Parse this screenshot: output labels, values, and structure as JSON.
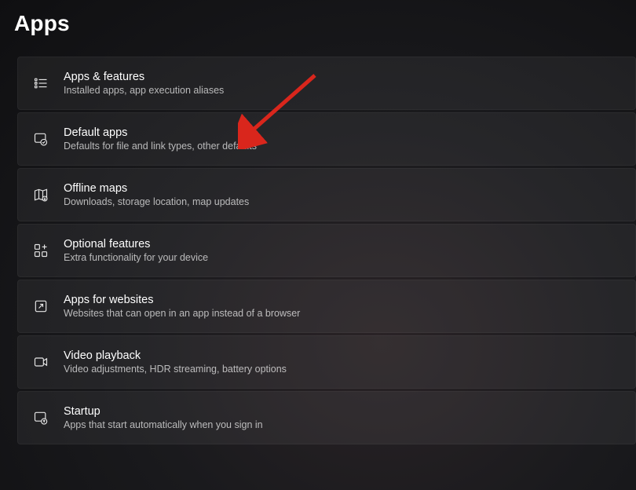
{
  "page": {
    "title": "Apps"
  },
  "items": [
    {
      "title": "Apps & features",
      "subtitle": "Installed apps, app execution aliases"
    },
    {
      "title": "Default apps",
      "subtitle": "Defaults for file and link types, other defaults"
    },
    {
      "title": "Offline maps",
      "subtitle": "Downloads, storage location, map updates"
    },
    {
      "title": "Optional features",
      "subtitle": "Extra functionality for your device"
    },
    {
      "title": "Apps for websites",
      "subtitle": "Websites that can open in an app instead of a browser"
    },
    {
      "title": "Video playback",
      "subtitle": "Video adjustments, HDR streaming, battery options"
    },
    {
      "title": "Startup",
      "subtitle": "Apps that start automatically when you sign in"
    }
  ]
}
